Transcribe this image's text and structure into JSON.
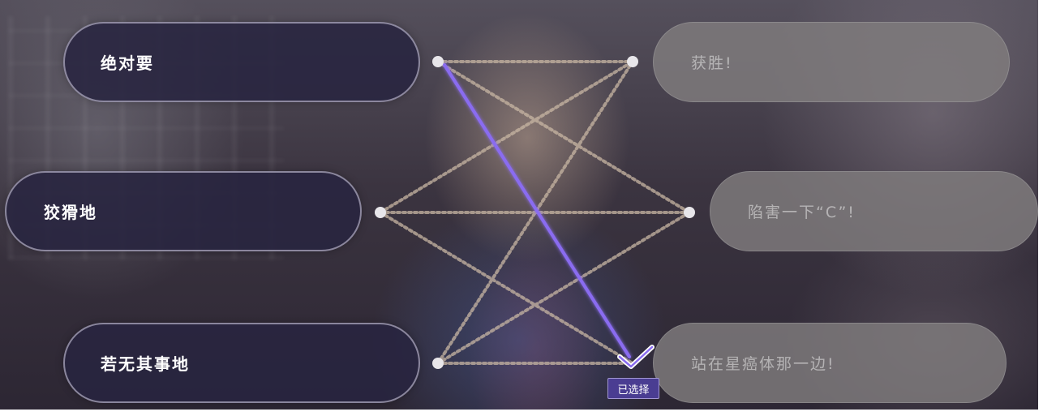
{
  "left_options": [
    {
      "label": "绝对要"
    },
    {
      "label": "狡猾地"
    },
    {
      "label": "若无其事地"
    }
  ],
  "right_options": [
    {
      "label": "获胜!"
    },
    {
      "label": "陷害一下“C”!"
    },
    {
      "label": "站在星癌体那一边!"
    }
  ],
  "selection": {
    "from_left_index": 1,
    "to_right_index": 3,
    "badge_label": "已选择",
    "line_color": "#8a6cf0"
  },
  "colors": {
    "left_pill_bg": "#28243f",
    "right_pill_bg": "#807c7e",
    "connector_dots": "#c9b7a4",
    "selection_accent": "#8a6cf0"
  },
  "icons": {
    "selected_marker": "check-icon"
  }
}
